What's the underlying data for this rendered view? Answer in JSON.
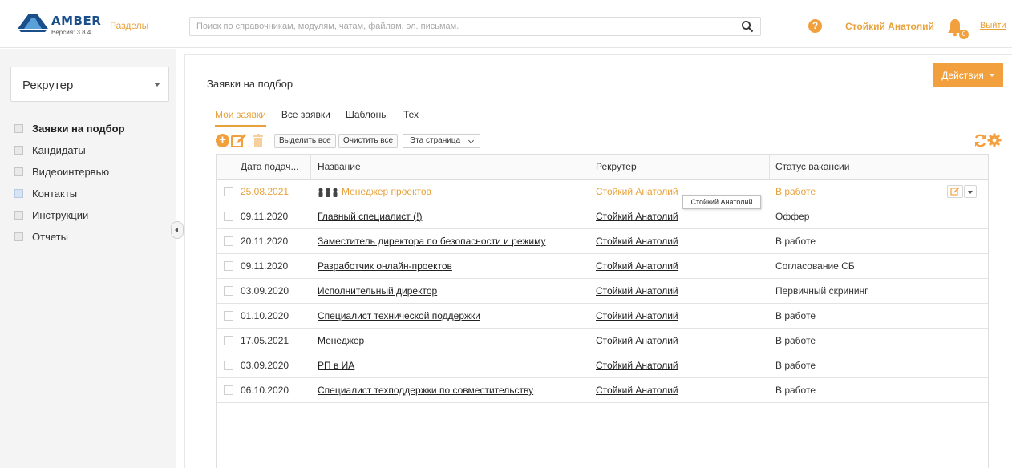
{
  "header": {
    "logo_text": "AMBER",
    "version": "Версия: 3.8.4",
    "sections_link": "Разделы",
    "search_placeholder": "Поиск по справочникам, модулям, чатам, файлам, эл. письмам.",
    "user_name": "Стойкий Анатолий",
    "notifications_count": "0",
    "logout_label": "Выйти",
    "accent_color": "#f2a03d"
  },
  "sidebar": {
    "role": "Рекрутер",
    "items": [
      {
        "label": "Заявки на подбор",
        "active": true
      },
      {
        "label": "Кандидаты",
        "active": false
      },
      {
        "label": "Видеоинтервью",
        "active": false
      },
      {
        "label": "Контакты",
        "active": false
      },
      {
        "label": "Инструкции",
        "active": false
      },
      {
        "label": "Отчеты",
        "active": false
      }
    ]
  },
  "main": {
    "title": "Заявки на подбор",
    "actions_label": "Действия",
    "tabs": [
      {
        "label": "Мои заявки",
        "active": true
      },
      {
        "label": "Все заявки",
        "active": false
      },
      {
        "label": "Шаблоны",
        "active": false
      },
      {
        "label": "Тех",
        "active": false
      }
    ],
    "toolbar": {
      "select_all": "Выделить все",
      "clear_all": "Очистить все",
      "page_scope": "Эта страница"
    },
    "table": {
      "columns": [
        "Дата подач...",
        "Название",
        "Рекрутер",
        "Статус вакансии"
      ],
      "rows": [
        {
          "date": "25.08.2021",
          "name": "Менеджер проектов",
          "recruiter": "Стойкий Анатолий",
          "status": "В работе"
        },
        {
          "date": "09.11.2020",
          "name": "Главный специалист (!)",
          "recruiter": "Стойкий Анатолий",
          "status": "Оффер"
        },
        {
          "date": "20.11.2020",
          "name": "Заместитель директора по безопасности и режиму",
          "recruiter": "Стойкий Анатолий",
          "status": "В работе"
        },
        {
          "date": "09.11.2020",
          "name": "Разработчик онлайн-проектов",
          "recruiter": "Стойкий Анатолий",
          "status": "Согласование СБ"
        },
        {
          "date": "03.09.2020",
          "name": "Исполнительный директор",
          "recruiter": "Стойкий Анатолий",
          "status": "Первичный скрининг"
        },
        {
          "date": "01.10.2020",
          "name": "Специалист технической поддержки",
          "recruiter": "Стойкий Анатолий",
          "status": "В работе"
        },
        {
          "date": "17.05.2021",
          "name": "Менеджер",
          "recruiter": "Стойкий Анатолий",
          "status": "В работе"
        },
        {
          "date": "03.09.2020",
          "name": "РП в ИА",
          "recruiter": "Стойкий Анатолий",
          "status": "В работе"
        },
        {
          "date": "06.10.2020",
          "name": "Специалист техподдержки по совместительству",
          "recruiter": "Стойкий Анатолий",
          "status": "В работе"
        }
      ]
    },
    "tooltip": "Стойкий Анатолий"
  }
}
